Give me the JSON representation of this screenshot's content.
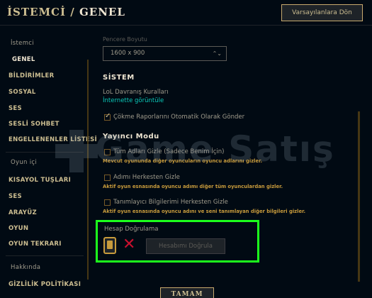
{
  "header": {
    "title_prefix": "İSTEMCİ /",
    "title_current": "GENEL",
    "reset_label": "Varsayılanlara Dön"
  },
  "sidebar": {
    "items": [
      {
        "label": "İstemci",
        "type": "category"
      },
      {
        "label": "GENEL",
        "type": "item",
        "active": true
      },
      {
        "label": "BİLDİRİMLER",
        "type": "item"
      },
      {
        "label": "SOSYAL",
        "type": "item"
      },
      {
        "label": "SES",
        "type": "item"
      },
      {
        "label": "SESLİ SOHBET",
        "type": "item"
      },
      {
        "label": "ENGELLENENLER LİSTESİ",
        "type": "item"
      },
      {
        "label": "Oyun içi",
        "type": "category"
      },
      {
        "label": "KISAYOL TUŞLARI",
        "type": "item"
      },
      {
        "label": "SES",
        "type": "item"
      },
      {
        "label": "ARAYÜZ",
        "type": "item"
      },
      {
        "label": "OYUN",
        "type": "item"
      },
      {
        "label": "OYUN TEKRARI",
        "type": "item"
      },
      {
        "label": "Hakkında",
        "type": "category"
      },
      {
        "label": "GİZLİLİK POLİTİKASI",
        "type": "item"
      }
    ]
  },
  "main": {
    "window_size_label": "Pencere Boyutu",
    "window_size_value": "1600 x 900",
    "system_title": "SİSTEM",
    "behavior_rules": "LoL Davranış Kuralları",
    "online_view_link": "İnternette görüntüle",
    "crash_reports_label": "Çökme Raporlarını Otomatik Olarak Gönder",
    "crash_reports_checked": true,
    "streamer_title": "Yayıncı Modu",
    "hide_all_names_label": "Tüm Adları Gizle (Sadece Benim İçin)",
    "hide_all_names_desc": "Mevcut oyununda diğer oyuncuların oyuncu adlarını gizler.",
    "hide_my_name_label": "Adımı Herkesten Gizle",
    "hide_my_name_desc": "Aktif oyun esnasında oyuncu adımı diğer tüm oyunculardan gizler.",
    "hide_identity_label": "Tanımlayıcı Bilgilerimi Herkesten Gizle",
    "hide_identity_desc": "Aktif oyun esnasında oyuncu adını ve seni tanımlayan diğer bilgileri gizler.",
    "account_verify_title": "Hesap Doğrulama",
    "verify_button_label": "Hesabımı Doğrula"
  },
  "footer": {
    "ok_label": "TAMAM"
  },
  "watermark": {
    "text": "Game Satış"
  },
  "colors": {
    "gold": "#c89b3c",
    "gold_light": "#cdbe91",
    "teal_link": "#0ac8b9",
    "highlight_green": "#1cff1c",
    "error_red": "#c8102e",
    "background": "#010a13"
  },
  "icons": {
    "phone": "phone-icon",
    "unverified": "x-icon",
    "dropdown": "chevron-updown-icon",
    "checkmark": "check-icon"
  }
}
